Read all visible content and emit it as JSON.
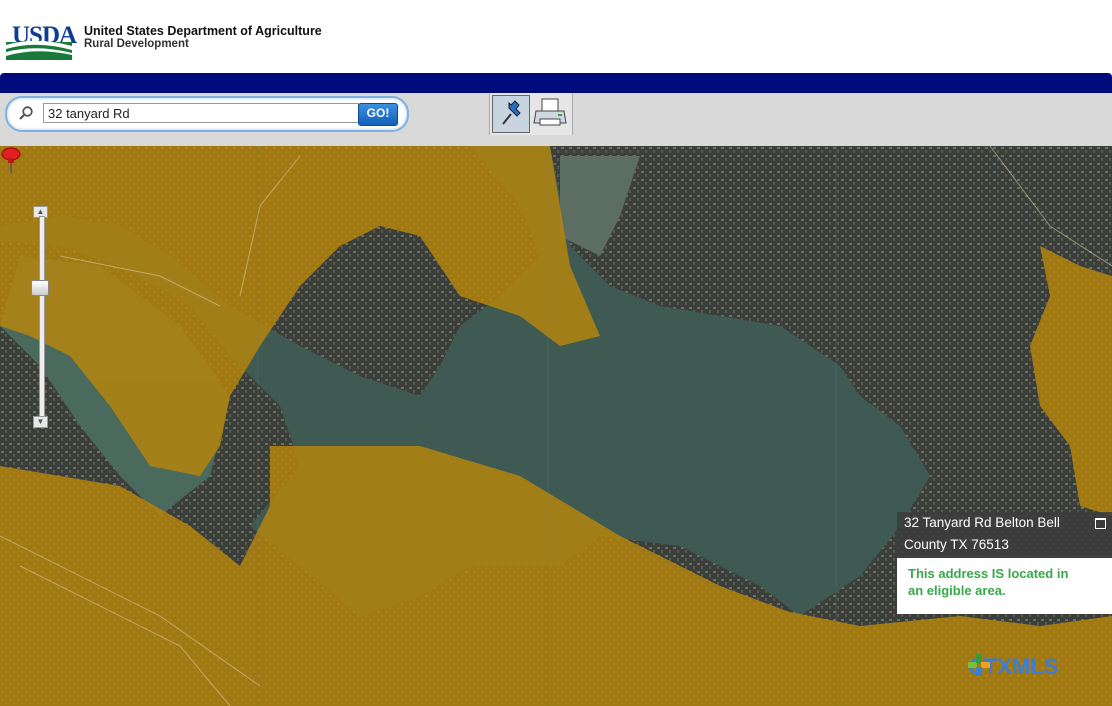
{
  "header": {
    "logo_text": "USDA",
    "agency_line1": "United States Department of Agriculture",
    "agency_line2": "Rural Development"
  },
  "search": {
    "value": "32 tanyard Rd",
    "go_label": "GO!"
  },
  "toolbar": {
    "tools": [
      "pushpin-icon",
      "printer-icon"
    ]
  },
  "map": {
    "popup_address_line1": "32 Tanyard Rd Belton Bell",
    "popup_address_line2": "County TX 76513",
    "popup_status_line1": "This address IS located in",
    "popup_status_line2": "an eligible area.",
    "watermark_logo": "CTXMLS",
    "eligible_overlay_color": "#b8860b",
    "status_color": "#39a84a"
  }
}
